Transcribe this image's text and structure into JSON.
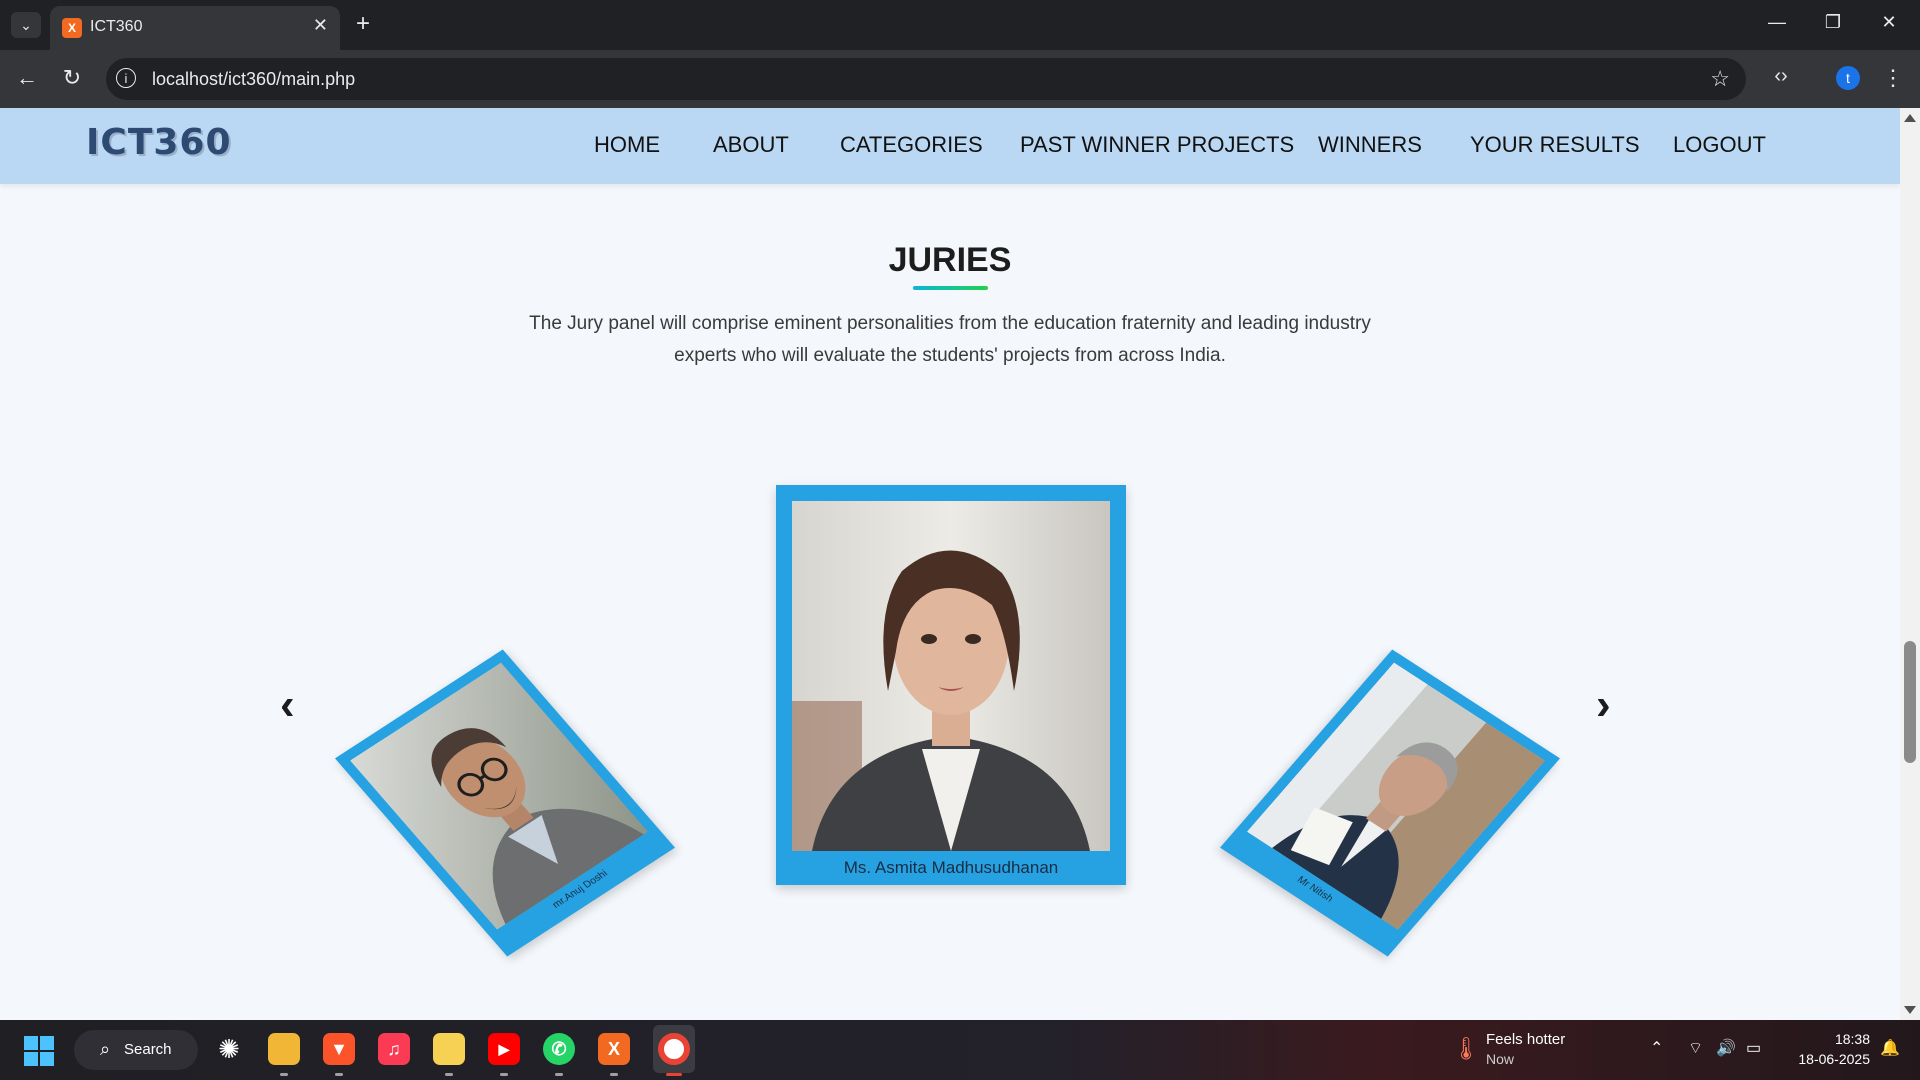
{
  "browser": {
    "tab_title": "ICT360",
    "favicon_label": "X",
    "url": "localhost/ict360/main.php",
    "profile_initial": "t"
  },
  "site": {
    "logo_text": "ICT360",
    "nav": [
      "HOME",
      "ABOUT",
      "CATEGORIES",
      "PAST WINNER PROJECTS",
      "WINNERS",
      "YOUR RESULTS",
      "LOGOUT"
    ]
  },
  "juries": {
    "title": "JURIES",
    "description": "The Jury panel will comprise eminent personalities from the education fraternity and leading industry experts who will evaluate the students' projects from across India.",
    "prev_arrow": "‹",
    "next_arrow": "›",
    "cards": {
      "left": {
        "name": "mr.Anuj Doshi"
      },
      "center": {
        "name": "Ms. Asmita Madhusudhanan"
      },
      "right": {
        "name": "Mr Nitish"
      }
    }
  },
  "taskbar": {
    "search_label": "Search",
    "weather_main": "Feels hotter",
    "weather_sub": "Now",
    "time": "18:38",
    "date": "18-06-2025"
  }
}
